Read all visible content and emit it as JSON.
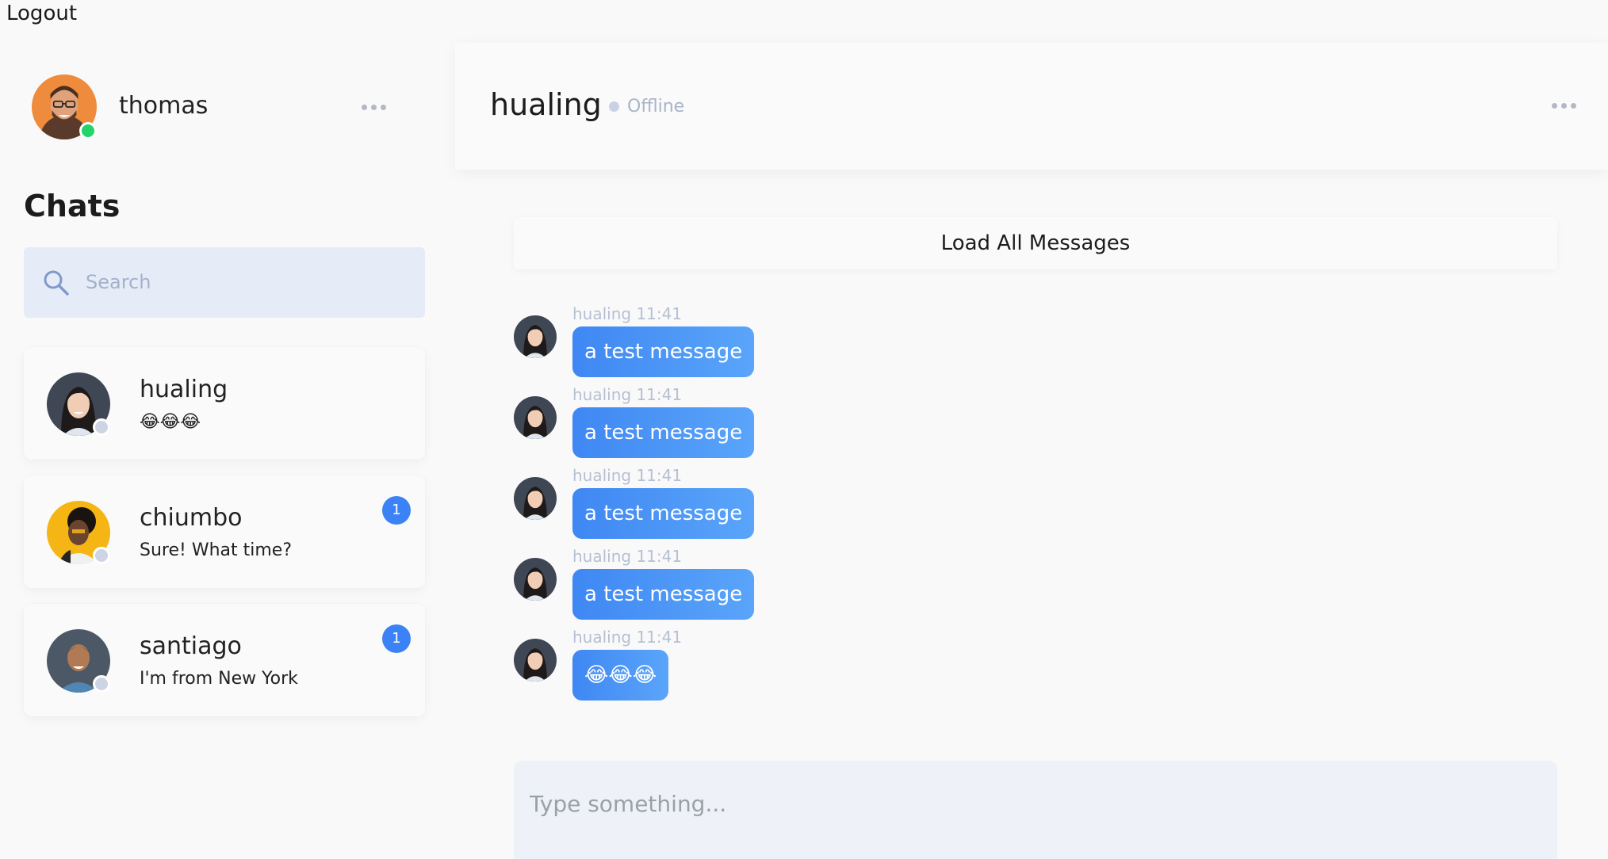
{
  "app": {
    "logout_label": "Logout"
  },
  "me": {
    "name": "thomas",
    "status": "online"
  },
  "sidebar": {
    "title": "Chats",
    "search_placeholder": "Search",
    "chats": [
      {
        "name": "hualing",
        "preview": "😂😂😂",
        "unread": null,
        "status": "offline"
      },
      {
        "name": "chiumbo",
        "preview": "Sure! What time?",
        "unread": "1",
        "status": "offline"
      },
      {
        "name": "santiago",
        "preview": "I'm from New York",
        "unread": "1",
        "status": "offline"
      }
    ]
  },
  "conversation": {
    "title": "hualing",
    "status_text": "Offline",
    "load_all_label": "Load All Messages",
    "messages": [
      {
        "meta": "hualing 11:41",
        "text": "a test message"
      },
      {
        "meta": "hualing 11:41",
        "text": "a test message"
      },
      {
        "meta": "hualing 11:41",
        "text": "a test message"
      },
      {
        "meta": "hualing 11:41",
        "text": "a test message"
      },
      {
        "meta": "hualing 11:41",
        "text": "😂😂😂"
      }
    ],
    "composer_placeholder": "Type something..."
  },
  "colors": {
    "accent": "#3b82f6",
    "online": "#22d46a",
    "offline": "#cdd5e4",
    "search_bg": "#e6ecf7"
  },
  "icons": {
    "search": "search-icon",
    "more": "more-dots-icon",
    "status": "status-dot-icon",
    "emoji": "laughing-emoji-icon"
  }
}
